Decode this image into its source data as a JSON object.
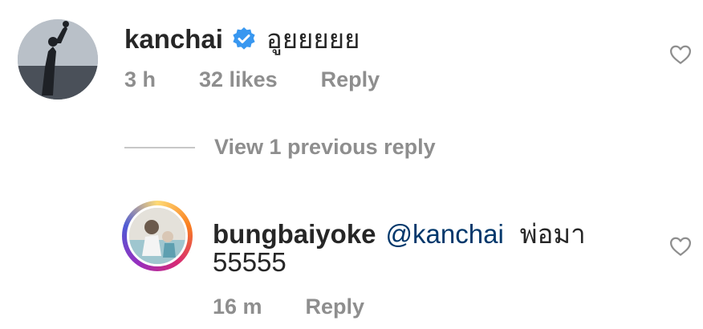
{
  "comments": [
    {
      "username": "kanchai",
      "text": "อูยยยยย",
      "time": "3 h",
      "likes": "32 likes",
      "reply_label": "Reply",
      "verified": true
    }
  ],
  "thread": {
    "view_replies_label": "View 1 previous reply"
  },
  "replies": [
    {
      "username": "bungbaiyoke",
      "mention": "@kanchai",
      "text_line1": "พ่อมา",
      "text_line2": "55555",
      "time": "16 m",
      "reply_label": "Reply"
    }
  ],
  "colors": {
    "username": "#262626",
    "meta": "#8e8e8e",
    "mention": "#00376b",
    "verified": "#3897f0"
  }
}
